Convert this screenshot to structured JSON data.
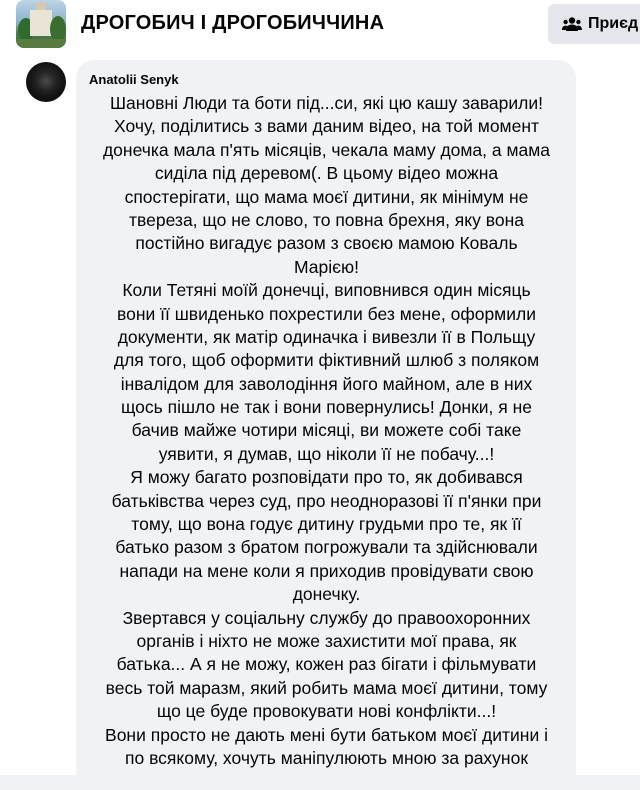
{
  "header": {
    "group_name": "ДРОГОБИЧ І ДРОГОБИЧЧИНА",
    "join_label": "Приєд"
  },
  "comment": {
    "author": "Anatolii Senyk",
    "lines": [
      "Шановні Люди та боти під...си, які цю кашу заварили!",
      "Хочу, поділитись з вами даним відео, на той момент",
      "донечка мала п'ять місяців, чекала маму дома, а мама",
      "сиділа під деревом(. В цьому відео можна",
      "спостерігати, що мама моєї дитини, як мінімум не",
      "твереза, що не слово, то повна брехня, яку вона",
      "постійно вигадує разом з своєю мамою Коваль",
      "Марією!",
      "Коли Тетяні моїй донечці, виповнився один місяць",
      "вони її швиденько похрестили без мене, оформили",
      "документи, як матір одиначка і вивезли її в Польщу",
      "для того, щоб оформити фіктивний шлюб з поляком",
      "інвалідом для заволодіння його майном, але в них",
      "щось пішло не так і вони повернулись! Донки, я не",
      "бачив майже чотири місяці, ви можете собі таке",
      "уявити, я думав, що ніколи її не побачу...!",
      "Я можу багато розповідати про то, як добивався",
      "батьківства через суд, про неодноразові її п'янки при",
      "тому, що вона годує дитину грудьми про те, як її",
      "батько разом з братом погрожували та здійснювали",
      "напади на мене коли я приходив провідувати свою",
      "донечку.",
      "Звертався у соціальну службу до правоохоронних",
      "органів і ніхто не може захистити мої права, як",
      "батька... А я не можу, кожен раз бігати і фільмувати",
      "весь той маразм, який робить мама моєї дитини, тому",
      "що це буде провокувати нові конфлікти...!",
      "Вони просто не дають мені бути батьком моєї дитини і",
      "по всякому, хочуть маніпулюють мною за рахунок"
    ]
  },
  "icons": {
    "join": "group-people-icon",
    "thumbnail": "group-thumbnail",
    "avatar": "user-avatar"
  },
  "colors": {
    "header_bg": "#ffffff",
    "bubble_bg": "#f0f2f5",
    "button_bg": "#e4e6eb",
    "text": "#050505"
  }
}
